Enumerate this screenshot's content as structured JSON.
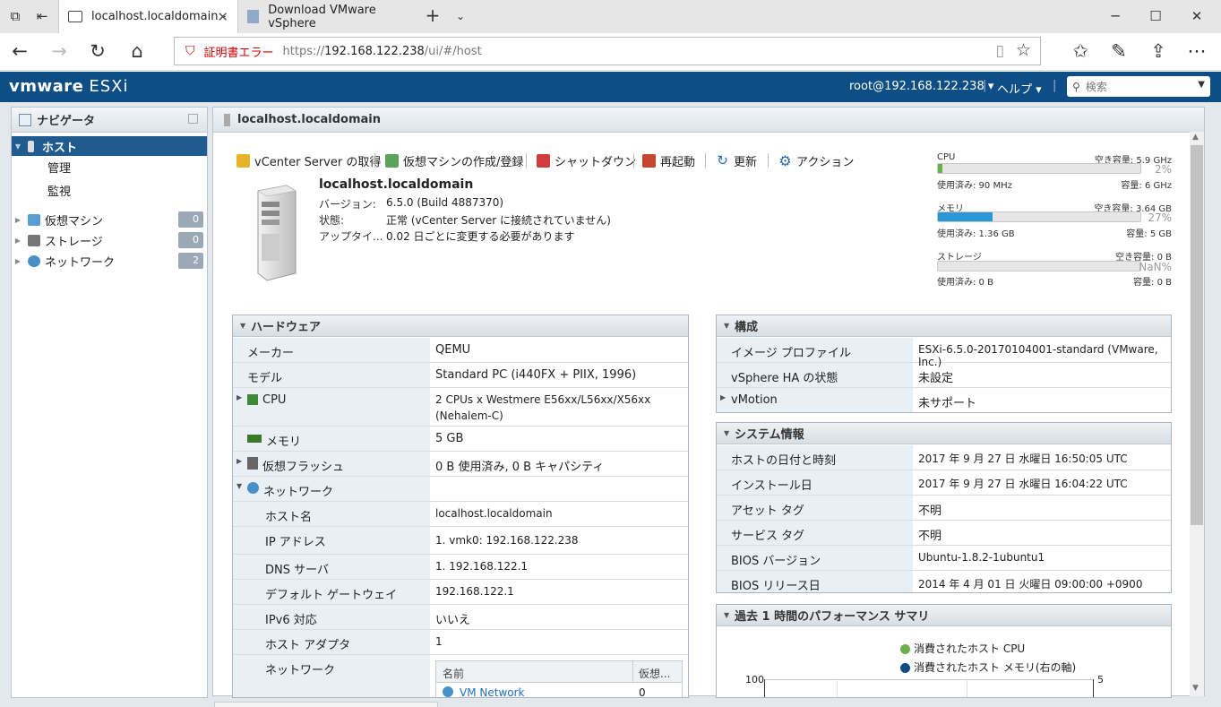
{
  "browser": {
    "tabs": [
      {
        "title": "localhost.localdomain -"
      },
      {
        "title": "Download VMware vSphere"
      }
    ],
    "address": {
      "cert_error": "証明書エラー",
      "url_scheme": "https://",
      "url_host": "192.168.122.238",
      "url_path": "/ui/#/host"
    }
  },
  "app": {
    "logo_brand": "vmware",
    "logo_product": "ESXi",
    "user": "root@192.168.122.238 ▾",
    "help": "ヘルプ ▾",
    "search_placeholder": "検索"
  },
  "navigator": {
    "title": "ナビゲータ",
    "host": "ホスト",
    "host_children": [
      "管理",
      "監視"
    ],
    "items": [
      {
        "label": "仮想マシン",
        "count": "0"
      },
      {
        "label": "ストレージ",
        "count": "0"
      },
      {
        "label": "ネットワーク",
        "count": "2"
      }
    ]
  },
  "content": {
    "title": "localhost.localdomain",
    "toolbar": [
      "vCenter Server の取得",
      "仮想マシンの作成/登録",
      "シャットダウン",
      "再起動",
      "更新",
      "アクション"
    ],
    "host": {
      "name": "localhost.localdomain",
      "version_label": "バージョン:",
      "version": "6.5.0 (Build 4887370)",
      "state_label": "状態:",
      "state": "正常 (vCenter Server に接続されていません)",
      "uptime_label": "アップタイ...",
      "uptime": "0.02 日ごとに変更する必要があります"
    },
    "meters": [
      {
        "name": "CPU",
        "free": "空き容量: 5.9 GHz",
        "pct": "2%",
        "pct_value": 2,
        "used": "使用済み: 90 MHz",
        "cap": "容量: 6 GHz",
        "color": "#6ab04c"
      },
      {
        "name": "メモリ",
        "free": "空き容量: 3.64 GB",
        "pct": "27%",
        "pct_value": 27,
        "used": "使用済み: 1.36 GB",
        "cap": "容量: 5 GB",
        "color": "#2a98d4"
      },
      {
        "name": "ストレージ",
        "free": "空き容量: 0 B",
        "pct": "NaN%",
        "pct_value": 0,
        "used": "使用済み: 0 B",
        "cap": "容量: 0 B",
        "color": "#2a98d4"
      }
    ],
    "hardware": {
      "title": "ハードウェア",
      "rows": [
        {
          "k": "メーカー",
          "v": "QEMU"
        },
        {
          "k": "モデル",
          "v": "Standard PC (i440FX + PIIX, 1996)"
        },
        {
          "k": "CPU",
          "v": "2 CPUs x Westmere E56xx/L56xx/X56xx",
          "v2": "(Nehalem-C)"
        },
        {
          "k": "メモリ",
          "v": "5 GB"
        },
        {
          "k": "仮想フラッシュ",
          "v": "0 B 使用済み, 0 B キャパシティ"
        },
        {
          "k": "ネットワーク",
          "v": ""
        },
        {
          "k": "ホスト名",
          "v": "localhost.localdomain"
        },
        {
          "k": "IP アドレス",
          "v": "1. vmk0: 192.168.122.238"
        },
        {
          "k": "DNS サーバ",
          "v": "1. 192.168.122.1"
        },
        {
          "k": "デフォルト ゲートウェイ",
          "v": "192.168.122.1"
        },
        {
          "k": "IPv6 対応",
          "v": "いいえ"
        },
        {
          "k": "ホスト アダプタ",
          "v": "1"
        },
        {
          "k": "ネットワーク",
          "v": ""
        }
      ],
      "net_table": {
        "col_name": "名前",
        "col_vm": "仮想...",
        "row_name": "VM Network",
        "row_vm": "0"
      }
    },
    "config": {
      "title": "構成",
      "rows": [
        {
          "k": "イメージ プロファイル",
          "v": "ESXi-6.5.0-20170104001-standard (VMware, Inc.)"
        },
        {
          "k": "vSphere HA の状態",
          "v": "未設定"
        },
        {
          "k": "vMotion",
          "v": "未サポート"
        }
      ]
    },
    "sysinfo": {
      "title": "システム情報",
      "rows": [
        {
          "k": "ホストの日付と時刻",
          "v": "2017 年 9 月 27 日 水曜日 16:50:05 UTC"
        },
        {
          "k": "インストール日",
          "v": "2017 年 9 月 27 日 水曜日 16:04:22 UTC"
        },
        {
          "k": "アセット タグ",
          "v": "不明"
        },
        {
          "k": "サービス タグ",
          "v": "不明"
        },
        {
          "k": "BIOS バージョン",
          "v": "Ubuntu-1.8.2-1ubuntu1"
        },
        {
          "k": "BIOS リリース日",
          "v": "2014 年 4 月 01 日 火曜日 09:00:00 +0900"
        }
      ]
    },
    "perf": {
      "title": "過去 1 時間のパフォーマンス サマリ",
      "legend_cpu": "消費されたホスト CPU",
      "legend_mem": "消費されたホスト メモリ(右の軸)",
      "y_left_top": "100",
      "y_right_top": "5",
      "cpu_color": "#6ab04c",
      "mem_color": "#0d4e87"
    }
  }
}
